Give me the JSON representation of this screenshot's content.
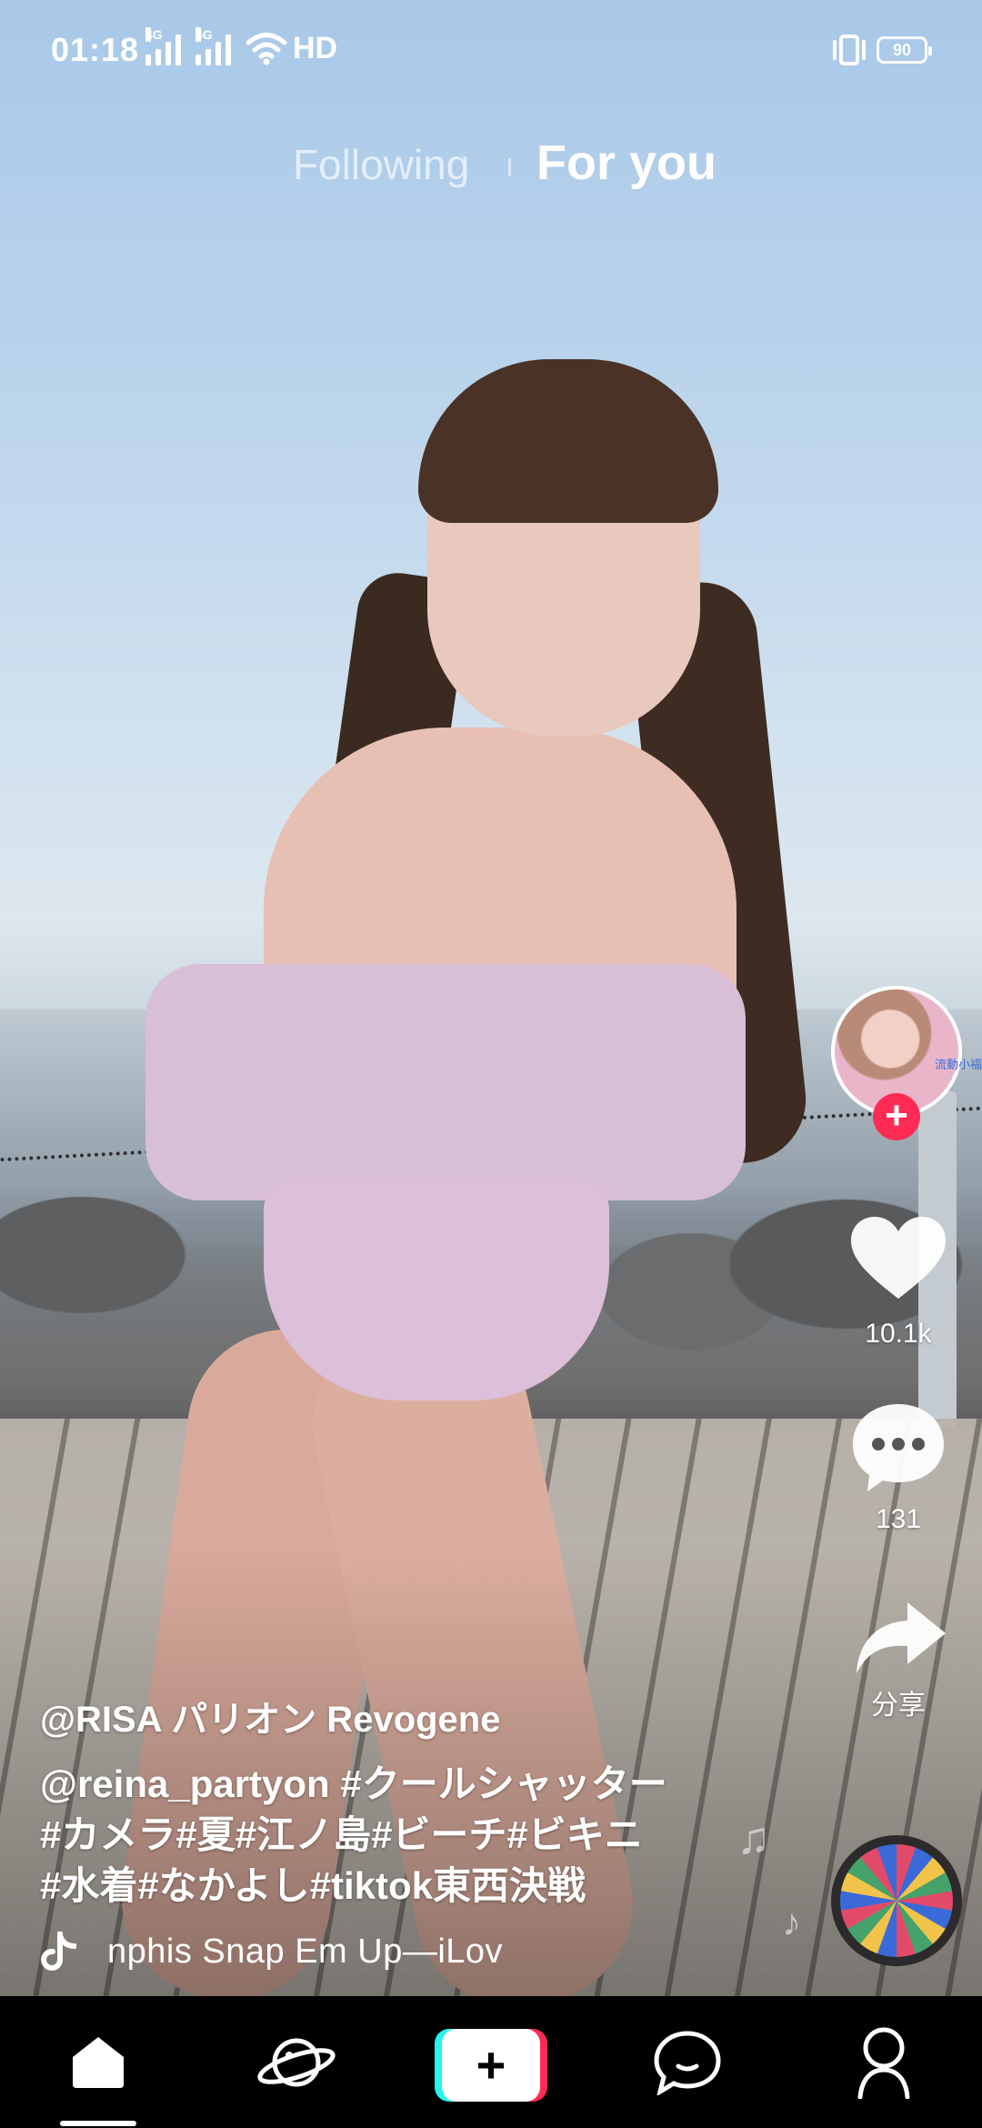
{
  "status_bar": {
    "time": "01:18",
    "network_1": "4G",
    "network_2": "4G",
    "hd": "HD",
    "battery": "90"
  },
  "top_tabs": {
    "following": "Following",
    "for_you": "For you",
    "active": "For you"
  },
  "video": {
    "avatar_tag": "流動小福",
    "likes": "10.1k",
    "comments": "131",
    "share": "分享"
  },
  "caption": {
    "author": "@RISA パリオン Revogene",
    "line1": "@reina_partyon  #クールシャッター",
    "line2": "#カメラ#夏#江ノ島#ビーチ#ビキニ",
    "line3": "#水着#なかよし#tiktok東西決戦"
  },
  "music": {
    "text": "nphis    Snap Em Up—iLov"
  },
  "bottom_nav": {
    "items": [
      "home",
      "discover",
      "create",
      "inbox",
      "me"
    ],
    "active": "home"
  },
  "colors": {
    "accent_red": "#fe2c55",
    "accent_cyan": "#25f4ee",
    "nav_bg": "#000000"
  }
}
